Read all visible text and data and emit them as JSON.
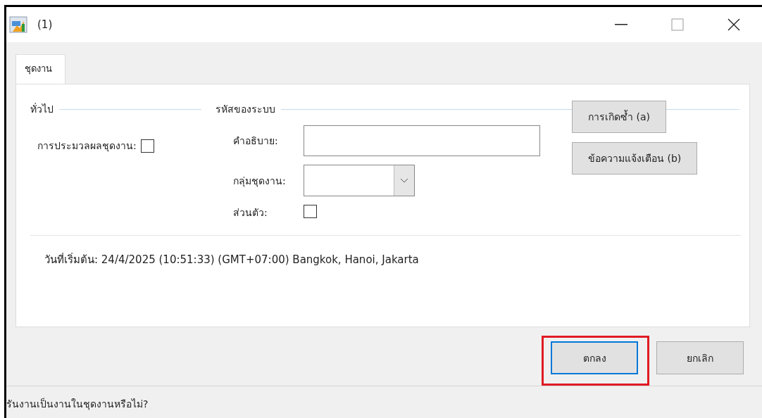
{
  "window": {
    "title": "(1)"
  },
  "tabs": [
    {
      "label": "ชุดงาน",
      "selected": true
    }
  ],
  "general": {
    "heading": "ทั่วไป",
    "batch_processing": {
      "label": "การประมวลผลชุดงาน:",
      "checked": false
    }
  },
  "system_code": {
    "heading": "รหัสของระบบ",
    "description": {
      "label": "คำอธิบาย:"
    },
    "batch_group": {
      "label": "กลุ่มชุดงาน:"
    },
    "private": {
      "label": "ส่วนตัว:",
      "checked": false
    }
  },
  "side_buttons": [
    {
      "label": "การเกิดซ้ำ (a)"
    },
    {
      "label": "ข้อความแจ้งเตือน (b)"
    }
  ],
  "start_date": "วันที่เริ่มต้น: 24/4/2025 (10:51:33) (GMT+07:00) Bangkok, Hanoi, Jakarta",
  "buttons": [
    {
      "label": "ตกลง",
      "focused": true,
      "highlighted": true
    },
    {
      "label": "ยกเลิก",
      "focused": false,
      "highlighted": false
    }
  ],
  "status_bar": "รันงานเป็นงานในชุดงานหรือไม่?"
}
